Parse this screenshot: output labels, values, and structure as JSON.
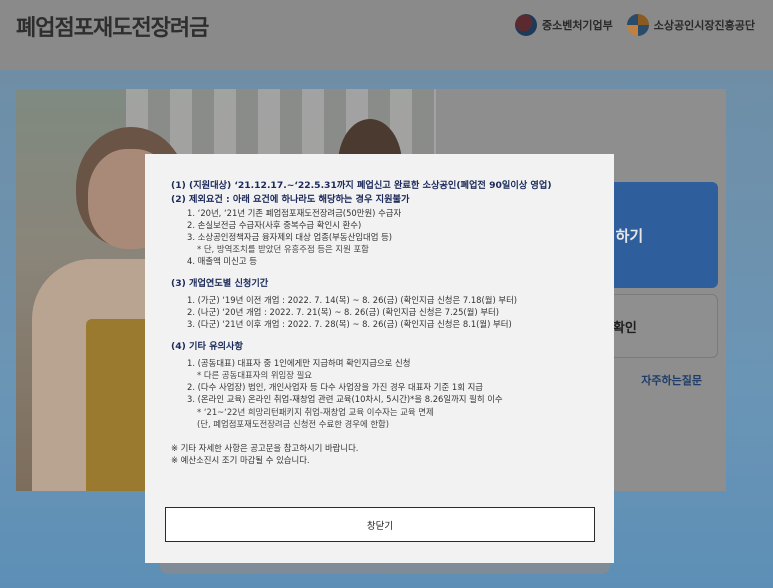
{
  "header": {
    "site_title": "폐업점포재도전장려금",
    "logo_mss_label": "중소벤처기업부",
    "logo_semas_label": "소상공인시장진흥공단"
  },
  "hero": {
    "apply_label": "신청하기",
    "result_label": "결과확인",
    "faq_label": "자주하는질문"
  },
  "modal": {
    "section1_title": "(1) (지원대상) ‘21.12.17.~‘22.5.31까지 폐업신고 완료한 소상공인(폐업전 90일이상 영업)",
    "section2_title": "(2) 제외요건 : 아래 요건에 하나라도 해당하는 경우 지원불가",
    "section2_items": [
      "1. ‘20년, ‘21년 기존 폐업점포재도전장려금(50만원) 수급자",
      "2. 손실보전금 수급자(사후 중복수급 확인시 환수)",
      "3. 소상공인정책자금 융자제외 대상 업종(부동산임대업 등)",
      "* 단, 방역조치를 받았던 유흥주점 등은 지원 포함",
      "4. 매출액 미신고 등"
    ],
    "section3_title": "(3) 개업연도별 신청기간",
    "section3_items": [
      "1. (가군) ‘19년 이전 개업 : 2022. 7. 14(목) ~ 8. 26(금) (확인지급 신청은 7.18(월) 부터)",
      "2. (나군) ‘20년 개업 : 2022. 7. 21(목) ~ 8. 26(금) (확인지급 신청은 7.25(월) 부터)",
      "3. (다군) ‘21년 이후 개업 : 2022. 7. 28(목) ~ 8. 26(금) (확인지급 신청은 8.1(월) 부터)"
    ],
    "section4_title": "(4) 기타 유의사항",
    "section4_items": [
      "1. (공동대표) 대표자 중 1인에게만 지급하며 확인지급으로 신청",
      "* 다른 공동대표자의 위임장 필요",
      "2. (다수 사업장) 법인, 개인사업자 등 다수 사업장을 가진 경우 대표자 기준 1회 지급",
      "3. (온라인 교육) 온라인 취업-재창업 관련 교육(10차시, 5시간)*을 8.26일까지 필히 이수",
      "* ‘21~‘22년 희망리턴패키지 취업-재창업 교육 이수자는 교육 면제",
      "(단, 폐업점포재도전장려금 신청전 수료한 경우에 한함)"
    ],
    "notes": [
      "※ 기타 자세한 사항은 공고문을 참고하시기 바랍니다.",
      "※ 예산소진시 조기 마감될 수 있습니다."
    ],
    "close_label": "창닫기"
  }
}
